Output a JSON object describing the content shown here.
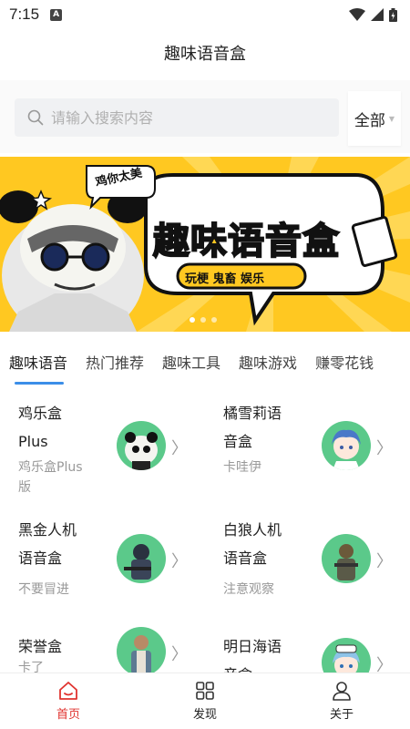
{
  "status_bar": {
    "time": "7:15",
    "notification_icon": "A"
  },
  "header": {
    "title": "趣味语音盒"
  },
  "search": {
    "placeholder": "请输入搜索内容",
    "filter_label": "全部"
  },
  "banner": {
    "bubble_text": "鸡你太美",
    "title": "趣味语音盒",
    "tags": "玩梗 鬼畜 娱乐",
    "dot_count": 3,
    "active_dot": 0
  },
  "tabs": [
    {
      "label": "趣味语音",
      "active": true
    },
    {
      "label": "热门推荐",
      "active": false
    },
    {
      "label": "趣味工具",
      "active": false
    },
    {
      "label": "趣味游戏",
      "active": false
    },
    {
      "label": "赚零花钱",
      "active": false
    }
  ],
  "items": [
    {
      "name": "鸡乐盒Plus",
      "name_lines": [
        "鸡乐盒",
        "Plus"
      ],
      "desc_lines": [
        "鸡乐盒Plus",
        "版"
      ],
      "avatar": "panda-avatar"
    },
    {
      "name": "橘雪莉语音盒",
      "name_lines": [
        "橘雪莉语",
        "音盒"
      ],
      "desc_lines": [
        "卡哇伊"
      ],
      "avatar": "anime-girl-avatar"
    },
    {
      "name": "黑金人机语音盒",
      "name_lines": [
        "黑金人机",
        "语音盒"
      ],
      "desc_lines": [
        "不要冒进"
      ],
      "avatar": "soldier-black-avatar"
    },
    {
      "name": "白狼人机语音盒",
      "name_lines": [
        "白狼人机",
        "语音盒"
      ],
      "desc_lines": [
        "注意观察"
      ],
      "avatar": "soldier-white-avatar"
    },
    {
      "name": "荣誉盒",
      "name_lines": [
        "荣誉盒"
      ],
      "desc_lines": [
        "卡了"
      ],
      "avatar": "soldier-vest-avatar"
    },
    {
      "name": "明日海语音盒",
      "name_lines": [
        "明日海语",
        "音盒"
      ],
      "desc_lines": [],
      "avatar": "anime-sailor-avatar"
    }
  ],
  "bottom_nav": [
    {
      "label": "首页",
      "icon": "home-icon",
      "active": true
    },
    {
      "label": "发现",
      "icon": "grid-icon",
      "active": false
    },
    {
      "label": "关于",
      "icon": "user-icon",
      "active": false
    }
  ],
  "colors": {
    "accent": "#e0332f",
    "tab_indicator": "#3b8ee8",
    "banner_bg": "#ffc821",
    "avatar_bg": "#5bc98a"
  }
}
